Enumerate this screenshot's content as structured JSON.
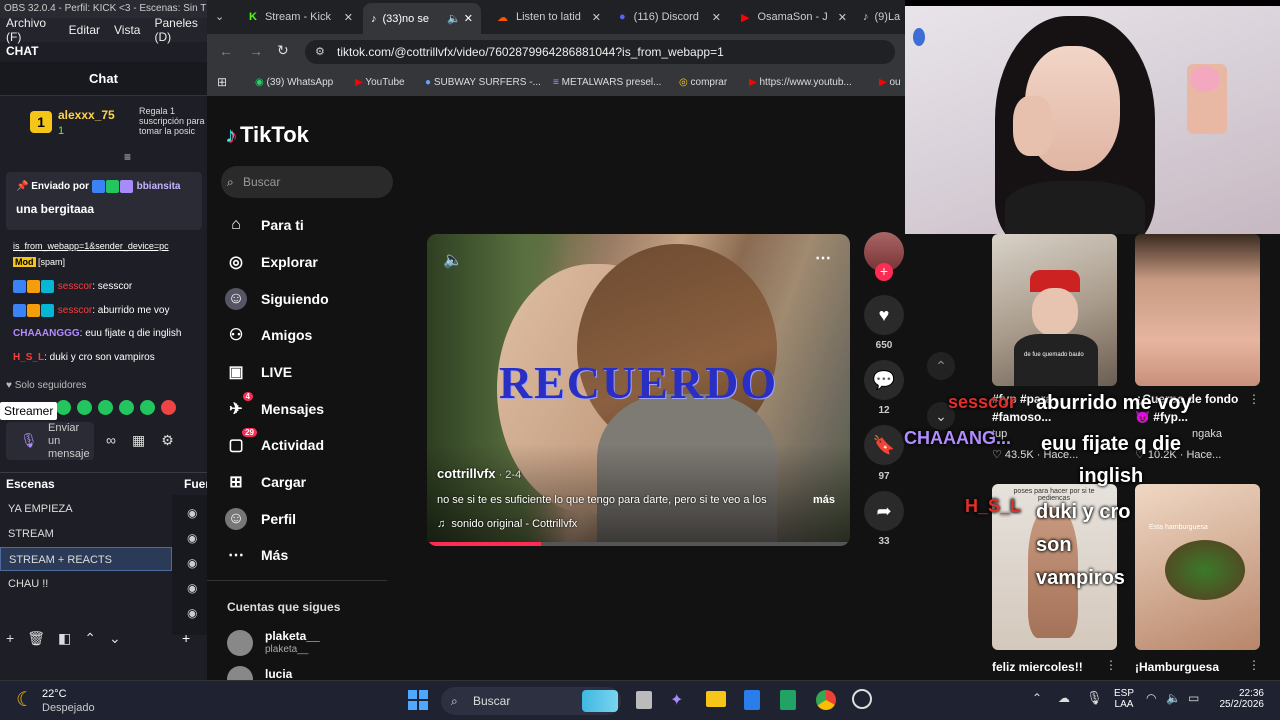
{
  "obs": {
    "title": "OBS 32.0.4 - Perfil: KICK <3 - Escenas: Sin T",
    "menu": [
      "Archivo (F)",
      "Editar",
      "Vista",
      "Paneles (D)"
    ],
    "chat_header": "CHAT",
    "chat_tab": "Chat",
    "gift": {
      "user": "alexxx_75",
      "count": "1",
      "rank": "1",
      "text": "Regala 1 suscripción para tomar la posic"
    },
    "pinned": {
      "label": "Enviado por",
      "user": "bbiansita",
      "message": "una bergitaaa"
    },
    "link_text": "is_from_webapp=1&sender_device=pc",
    "mod_badge": "Mod",
    "spam_tag": "[spam]",
    "messages": [
      {
        "user": "sesscor",
        "text": ": sesscor",
        "color": "#ff3b3b"
      },
      {
        "user": "sesscor",
        "text": ": aburrido me voy",
        "color": "#ff3b3b"
      },
      {
        "user": "CHAAANGGG",
        "text": ": euu fijate q die inglish",
        "color": "#b18cff"
      },
      {
        "user": "H_S_L",
        "text": ": duki y cro son vampiros",
        "color": "#ff3b3b"
      }
    ],
    "followers_only": "Solo seguidores",
    "streamer_tooltip": "Streamer",
    "send_placeholder": "Enviar un mensaje",
    "scenes_header": "Escenas",
    "sources_header": "Fuer",
    "scenes": [
      "YA EMPIEZA",
      "STREAM",
      "STREAM + REACTS",
      "CHAU !!"
    ],
    "selected_scene": "STREAM + REACTS"
  },
  "browser": {
    "tabs": [
      {
        "label": "Stream - Kick",
        "icon": "K",
        "color": "#53fc18"
      },
      {
        "label": "(33)no se",
        "icon": "♪",
        "color": "#fff"
      },
      {
        "label": "Listen to latid",
        "icon": "☁",
        "color": "#ff5500"
      },
      {
        "label": "(116) Discord",
        "icon": "●",
        "color": "#5865f2"
      },
      {
        "label": "OsamaSon - J",
        "icon": "▶",
        "color": "#ff0000"
      },
      {
        "label": "(9)La",
        "icon": "♪",
        "color": "#fff"
      }
    ],
    "url": "tiktok.com/@cottrillvfx/video/7602879964286881044?is_from_webapp=1",
    "bookmarks": [
      "(39) WhatsApp",
      "YouTube",
      "SUBWAY SURFERS -...",
      "METALWARS presel...",
      "comprar",
      "https://www.youtub...",
      "ou"
    ]
  },
  "tiktok": {
    "logo": "TikTok",
    "search_placeholder": "Buscar",
    "nav": [
      {
        "label": "Para ti",
        "icon": "home-icon"
      },
      {
        "label": "Explorar",
        "icon": "compass-icon"
      },
      {
        "label": "Siguiendo",
        "icon": "following-icon"
      },
      {
        "label": "Amigos",
        "icon": "friends-icon"
      },
      {
        "label": "LIVE",
        "icon": "live-icon"
      },
      {
        "label": "Mensajes",
        "icon": "message-icon",
        "badge": "4"
      },
      {
        "label": "Actividad",
        "icon": "activity-icon",
        "badge": "29"
      },
      {
        "label": "Cargar",
        "icon": "upload-icon"
      },
      {
        "label": "Perfil",
        "icon": "profile-icon"
      },
      {
        "label": "Más",
        "icon": "more-icon"
      }
    ],
    "following_header": "Cuentas que sigues",
    "following": [
      {
        "name": "plaketa__",
        "handle": "plaketa__"
      },
      {
        "name": "lucia",
        "handle": ""
      }
    ],
    "video": {
      "overlay_text": "RECUERDO",
      "author": "cottrillvfx",
      "date": " · 2-4",
      "caption": "no se si te es suficiente lo que tengo para darte, pero si te veo a los",
      "more": "más",
      "sound": "sonido original - Cottrillvfx",
      "progress": 0.27
    },
    "actions": {
      "likes": "650",
      "comments": "12",
      "saves": "97",
      "shares": "33"
    }
  },
  "feed": {
    "items": [
      {
        "title": "#fyp #para #famoso...",
        "extra": "tup",
        "likes": "43.5K",
        "time": "Hace...",
        "caption": "de fue quemado baulo"
      },
      {
        "title": "¿Cuerpo de fondo 😈 #fyp...",
        "extra": "ngaka",
        "likes": "10.2K",
        "time": "Hace...",
        "caption": ""
      },
      {
        "title": "feliz miercoles!!",
        "extra": "",
        "likes": "",
        "time": "",
        "caption": "poses para hacer por si te pediencas"
      },
      {
        "title": "¡Hamburguesa",
        "extra": "",
        "likes": "",
        "time": "",
        "caption": "Esta hamburguesa"
      }
    ]
  },
  "overlay": [
    {
      "user": "sesscor",
      "text": "aburrido me voy"
    },
    {
      "user": "CHAAANG...",
      "text": "euu fijate q die inglish"
    },
    {
      "user": "H_S_L",
      "text": "duki y cro son vampiros"
    }
  ],
  "taskbar": {
    "weather_temp": "22°C",
    "weather_desc": "Despejado",
    "search": "Buscar",
    "lang": "ESP",
    "lang2": "LAA",
    "time": "22:36",
    "date": "25/2/2026"
  },
  "colors": {
    "tiktok_red": "#fe2c55",
    "kick_green": "#53fc18",
    "selected_scene_bg": "#2b3a57"
  }
}
